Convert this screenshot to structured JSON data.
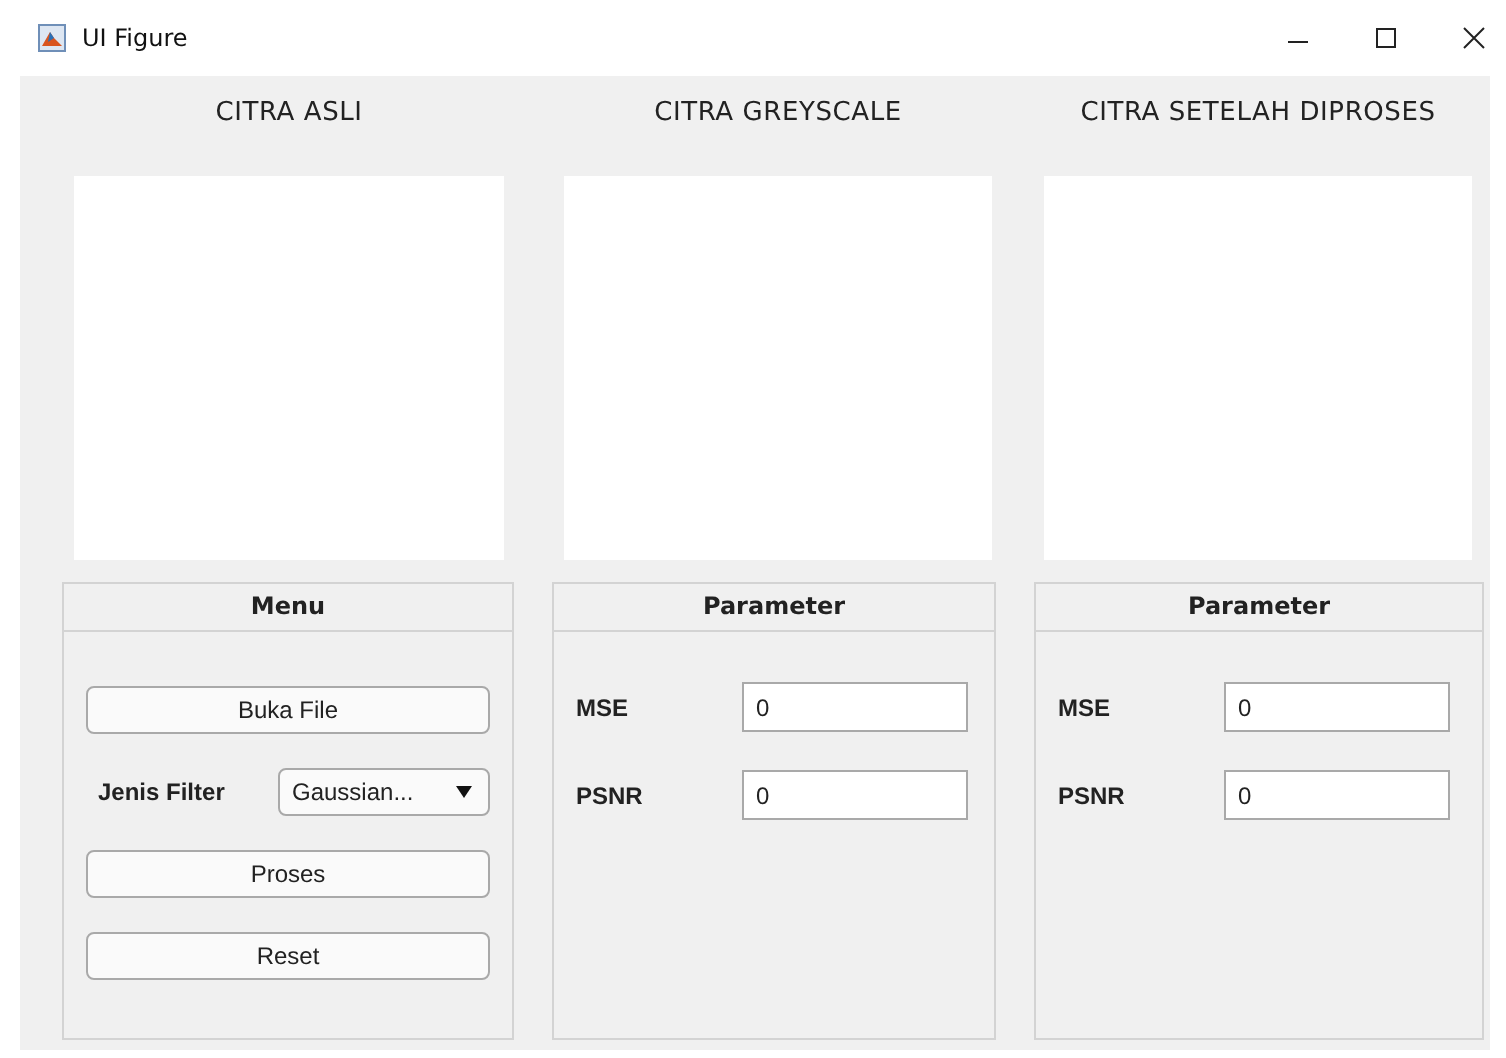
{
  "window": {
    "title": "UI Figure"
  },
  "images": [
    {
      "title": "CITRA ASLI"
    },
    {
      "title": "CITRA GREYSCALE"
    },
    {
      "title": "CITRA SETELAH DIPROSES"
    }
  ],
  "menu_panel": {
    "title": "Menu",
    "buttons": [
      "Buka File",
      "Proses",
      "Reset"
    ],
    "filter": {
      "label": "Jenis Filter",
      "value": "Gaussian..."
    }
  },
  "parameter_panels": [
    {
      "title": "Parameter",
      "fields": [
        {
          "label": "MSE",
          "value": "0"
        },
        {
          "label": "PSNR",
          "value": "0"
        }
      ]
    },
    {
      "title": "Parameter",
      "fields": [
        {
          "label": "MSE",
          "value": "0"
        },
        {
          "label": "PSNR",
          "value": "0"
        }
      ]
    }
  ]
}
